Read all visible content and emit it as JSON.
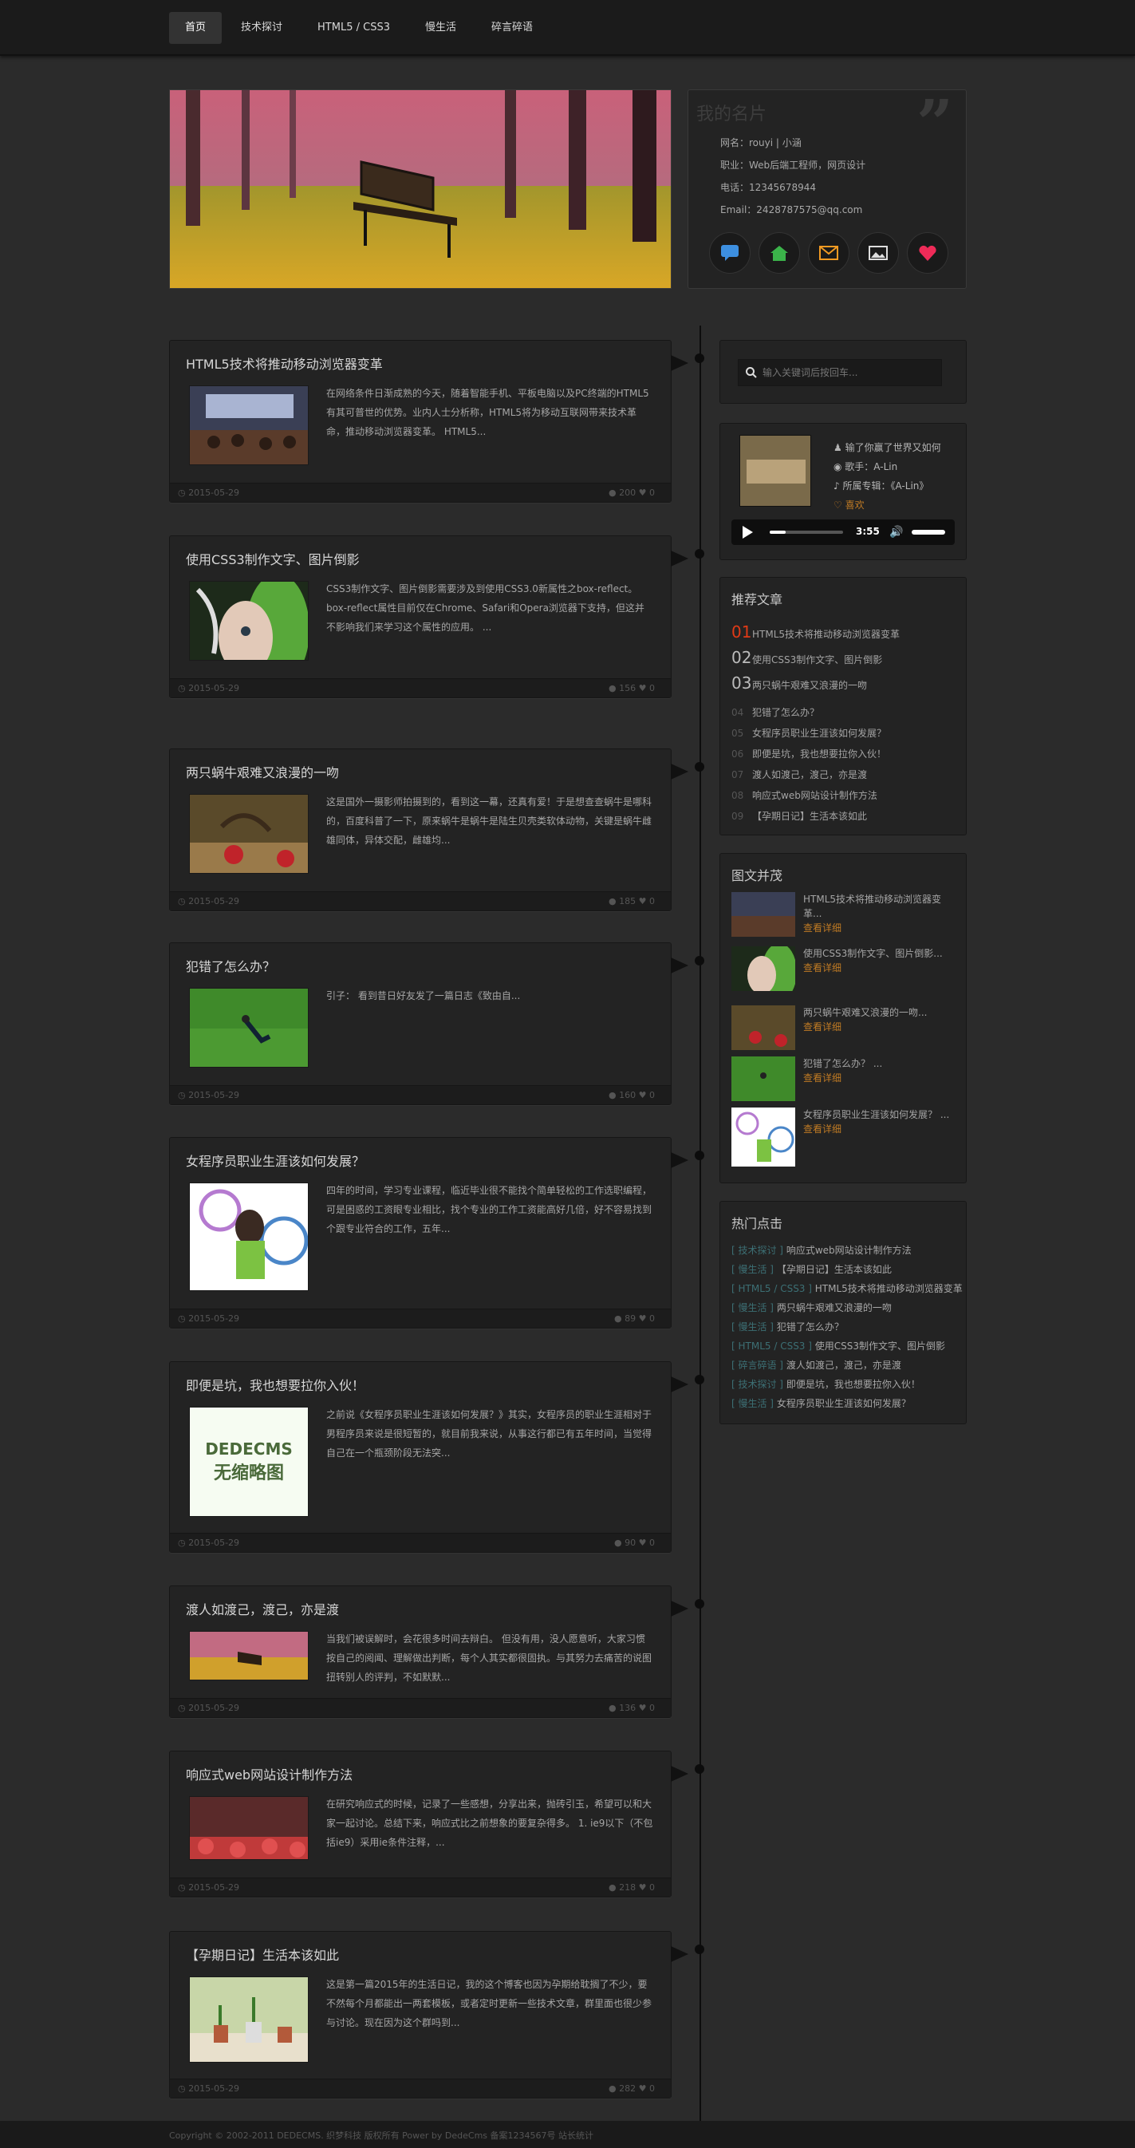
{
  "nav": [
    "首页",
    "技术探讨",
    "HTML5 / CSS3",
    "慢生活",
    "碎言碎语"
  ],
  "card": {
    "title": "我的名片",
    "rows": [
      "网名：rouyi | 小涵",
      "职业：Web后端工程师，网页设计",
      "电话：12345678944",
      "Email：2428787575@qq.com"
    ],
    "icons": [
      "chat-icon",
      "home-icon",
      "mail-icon",
      "gallery-icon",
      "heart-icon"
    ]
  },
  "articles": [
    {
      "title": "HTML5技术将推动移动浏览器变革",
      "excerpt": "在网络条件日渐成熟的今天，随着智能手机、平板电脑以及PC终端的HTML5有其可普世的优势。业内人士分析称，HTML5将为移动互联网带来技术革命，推动移动浏览器变革。 HTML5...",
      "date": "2015-05-29",
      "views": "200",
      "likes": "0"
    },
    {
      "title": "使用CSS3制作文字、图片倒影",
      "excerpt": "CSS3制作文字、图片倒影需要涉及到使用CSS3.0新属性之box-reflect。box-reflect属性目前仅在Chrome、Safari和Opera浏览器下支持，但这并不影响我们来学习这个属性的应用。 ...",
      "date": "2015-05-29",
      "views": "156",
      "likes": "0"
    },
    {
      "title": "两只蜗牛艰难又浪漫的一吻",
      "excerpt": "这是国外一摄影师拍摄到的，看到这一幕，还真有爱！于是想查查蜗牛是哪科的，百度科普了一下，原来蜗牛是蜗牛是陆生贝壳类软体动物，关键是蜗牛雌雄同体，异体交配，雌雄均...",
      "date": "2015-05-29",
      "views": "185",
      "likes": "0"
    },
    {
      "title": "犯错了怎么办？",
      "excerpt": "引子： 看到昔日好友发了一篇日志《致由自...",
      "date": "2015-05-29",
      "views": "160",
      "likes": "0"
    },
    {
      "title": "女程序员职业生涯该如何发展？",
      "excerpt": "四年的时间，学习专业课程，临近毕业很不能找个简单轻松的工作选职编程，可是困惑的工资眼专业相比，找个专业的工作工资能高好几倍，好不容易找到个跟专业符合的工作，五年...",
      "date": "2015-05-29",
      "views": "89",
      "likes": "0"
    },
    {
      "title": "即便是坑，我也想要拉你入伙！",
      "excerpt": "之前说《女程序员职业生涯该如何发展？》其实，女程序员的职业生涯相对于男程序员来说是很短暂的，就目前我来说，从事这行都已有五年时间，当觉得自己在一个瓶颈阶段无法突...",
      "date": "2015-05-29",
      "views": "90",
      "likes": "0",
      "thumb_text": [
        "DEDECMS",
        "无缩略图"
      ]
    },
    {
      "title": "渡人如渡己，渡己，亦是渡",
      "excerpt": "当我们被误解时，会花很多时间去辩白。 但没有用，没人愿意听，大家习惯按自己的阅闻、理解做出判断，每个人其实都很固执。与其努力去痛苦的说图扭转别人的评判，不如默默...",
      "date": "2015-05-29",
      "views": "136",
      "likes": "0"
    },
    {
      "title": "响应式web网站设计制作方法",
      "excerpt": "在研究响应式的时候，记录了一些感想，分享出来，抛砖引玉，希望可以和大家一起讨论。总结下来，响应式比之前想象的要复杂得多。 1. ie9以下（不包括ie9）采用ie条件注释，...",
      "date": "2015-05-29",
      "views": "218",
      "likes": "0"
    },
    {
      "title": "【孕期日记】生活本该如此",
      "excerpt": "这是第一篇2015年的生活日记，我的这个博客也因为孕期给耽搁了不少，要不然每个月都能出一两套模板，或者定时更新一些技术文章，群里面也很少参与讨论。现在因为这个群吗到...",
      "date": "2015-05-29",
      "views": "282",
      "likes": "0"
    }
  ],
  "search": {
    "placeholder": "输入关键词后按回车..."
  },
  "music": {
    "song": "输了你赢了世界又如何",
    "singer": "歌手：A-Lin",
    "album": "所属专辑：《A-Lin》",
    "like": "喜欢",
    "time": "3:55"
  },
  "recommend": {
    "title": "推荐文章",
    "items": [
      {
        "num": "01",
        "text": "HTML5技术将推动移动浏览器变革"
      },
      {
        "num": "02",
        "text": "使用CSS3制作文字、图片倒影"
      },
      {
        "num": "03",
        "text": "两只蜗牛艰难又浪漫的一吻"
      },
      {
        "num": "04",
        "text": "犯错了怎么办？"
      },
      {
        "num": "05",
        "text": "女程序员职业生涯该如何发展？"
      },
      {
        "num": "06",
        "text": "即便是坑，我也想要拉你入伙！"
      },
      {
        "num": "07",
        "text": "渡人如渡己，渡己，亦是渡"
      },
      {
        "num": "08",
        "text": "响应式web网站设计制作方法"
      },
      {
        "num": "09",
        "text": "【孕期日记】生活本该如此"
      }
    ]
  },
  "pictures": {
    "title": "图文并茂",
    "items": [
      {
        "text": "HTML5技术将推动移动浏览器变革...",
        "more": "查看详细"
      },
      {
        "text": "使用CSS3制作文字、图片倒影...",
        "more": "查看详细"
      },
      {
        "text": "两只蜗牛艰难又浪漫的一吻...",
        "more": "查看详细"
      },
      {
        "text": "犯错了怎么办？ ...",
        "more": "查看详细"
      },
      {
        "text": "女程序员职业生涯该如何发展？ ...",
        "more": "查看详细"
      }
    ]
  },
  "hot": {
    "title": "热门点击",
    "items": [
      {
        "tag": "[ 技术探讨 ]",
        "text": "响应式web网站设计制作方法"
      },
      {
        "tag": "[ 慢生活 ]",
        "text": "【孕期日记】生活本该如此"
      },
      {
        "tag": "[ HTML5 / CSS3 ]",
        "text": "HTML5技术将推动移动浏览器变革"
      },
      {
        "tag": "[ 慢生活 ]",
        "text": "两只蜗牛艰难又浪漫的一吻"
      },
      {
        "tag": "[ 慢生活 ]",
        "text": "犯错了怎么办？"
      },
      {
        "tag": "[ HTML5 / CSS3 ]",
        "text": "使用CSS3制作文字、图片倒影"
      },
      {
        "tag": "[ 碎言碎语 ]",
        "text": "渡人如渡己，渡己，亦是渡"
      },
      {
        "tag": "[ 技术探讨 ]",
        "text": "即便是坑，我也想要拉你入伙！"
      },
      {
        "tag": "[ 慢生活 ]",
        "text": "女程序员职业生涯该如何发展？"
      }
    ]
  },
  "footer": "Copyright © 2002-2011 DEDECMS. 织梦科技 版权所有 Power by DedeCms 备案1234567号 站长统计"
}
